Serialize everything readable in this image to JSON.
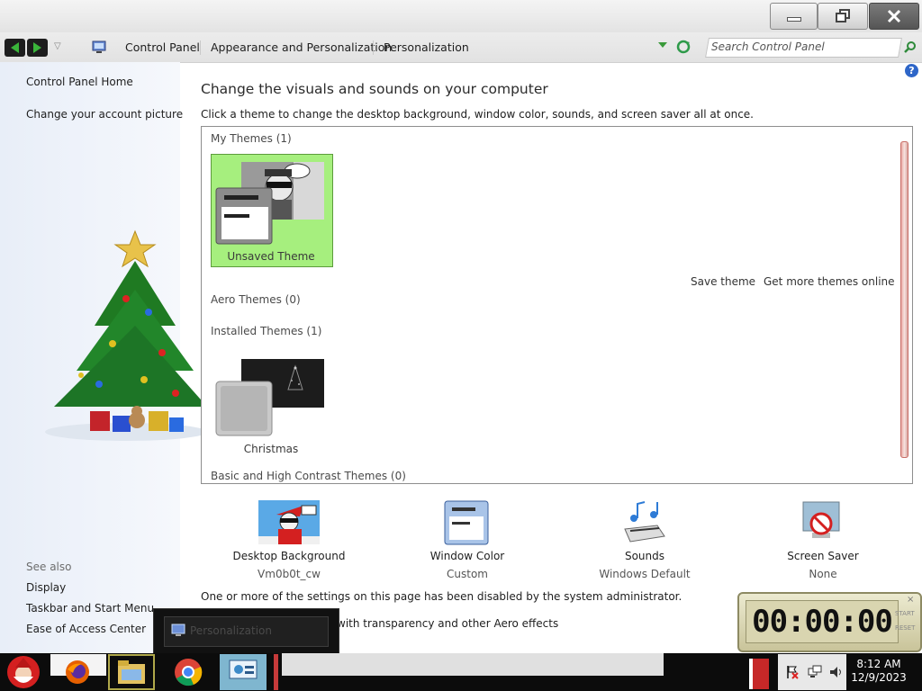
{
  "window": {
    "minimize_icon": "minimize-icon",
    "maximize_icon": "restore-icon",
    "close_icon": "close-icon"
  },
  "addressbar": {
    "breadcrumbs": [
      "Control Panel",
      "Appearance and Personalization",
      "Personalization"
    ],
    "search_placeholder": "Search Control Panel"
  },
  "sidebar": {
    "links": [
      "Control Panel Home",
      "Change your account picture"
    ],
    "see_also_title": "See also",
    "see_also": [
      "Display",
      "Taskbar and Start Menu",
      "Ease of Access Center"
    ]
  },
  "main": {
    "heading": "Change the visuals and sounds on your computer",
    "subtext": "Click a theme to change the desktop background, window color, sounds, and screen saver all at once.",
    "groups": {
      "my_themes": "My Themes (1)",
      "aero_themes": "Aero Themes (0)",
      "installed_themes": "Installed Themes (1)",
      "basic_themes": "Basic and High Contrast Themes (0)"
    },
    "themes": {
      "unsaved": "Unsaved Theme",
      "christmas": "Christmas"
    },
    "actions": {
      "save_theme": "Save theme",
      "get_more": "Get more themes online"
    },
    "tiles": [
      {
        "label": "Desktop Background",
        "value": "Vm0b0t_cw"
      },
      {
        "label": "Window Color",
        "value": "Custom"
      },
      {
        "label": "Sounds",
        "value": "Windows Default"
      },
      {
        "label": "Screen Saver",
        "value": "None"
      }
    ],
    "disabled_notice": "One or more of the settings on this page has been disabled by the system administrator.",
    "transparency_text": "with transparency and other Aero effects"
  },
  "tooltip": {
    "label": "Personalization"
  },
  "timer": {
    "display": "00:00:00",
    "start_label": "START",
    "reset_label": "RESET"
  },
  "taskbar": {
    "time": "8:12 AM",
    "date": "12/9/2023"
  },
  "colors": {
    "selected_theme_bg": "#a6ef7e",
    "title_bar": "#e8e8e8",
    "taskbar": "#0c0c0c"
  }
}
